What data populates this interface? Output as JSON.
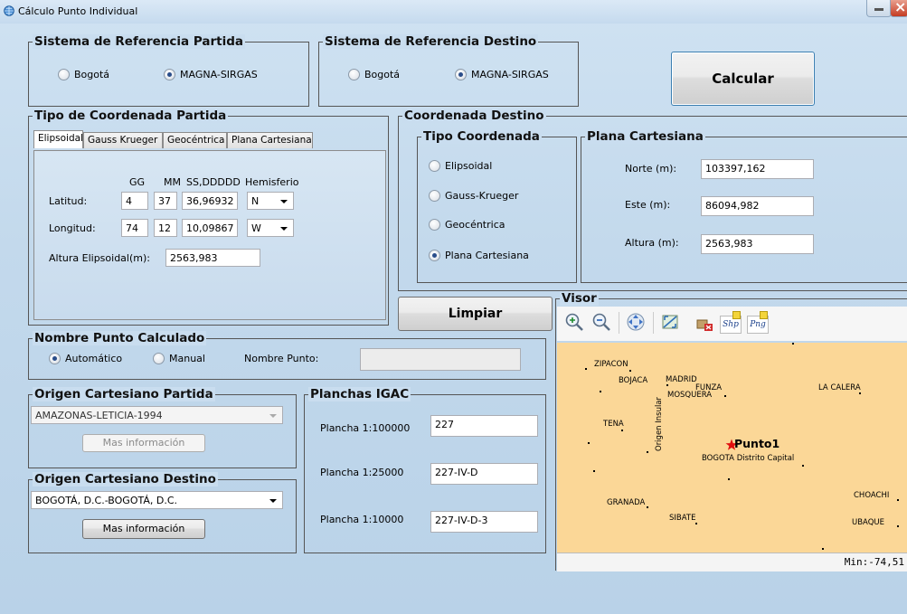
{
  "window": {
    "title": "Cálculo Punto Individual"
  },
  "ref_partida": {
    "title": "Sistema de Referencia Partida",
    "options": [
      "Bogotá",
      "MAGNA-SIRGAS"
    ],
    "selected": "MAGNA-SIRGAS"
  },
  "ref_destino": {
    "title": "Sistema de Referencia Destino",
    "options": [
      "Bogotá",
      "MAGNA-SIRGAS"
    ],
    "selected": "MAGNA-SIRGAS"
  },
  "calcular": {
    "label": "Calcular"
  },
  "tipo_partida": {
    "title": "Tipo de Coordenada Partida",
    "tabs": [
      "Elipsoidal",
      "Gauss Krueger",
      "Geocéntrica",
      "Plana Cartesiana"
    ],
    "active_tab": "Elipsoidal",
    "headers": {
      "gg": "GG",
      "mm": "MM",
      "ss": "SS,DDDDD",
      "hem": "Hemisferio"
    },
    "latitud": {
      "label": "Latitud:",
      "gg": "4",
      "mm": "37",
      "ss": "36,96932",
      "hem": "N"
    },
    "longitud": {
      "label": "Longitud:",
      "gg": "74",
      "mm": "12",
      "ss": "10,09867",
      "hem": "W"
    },
    "altura": {
      "label": "Altura Elipsoidal(m):",
      "value": "2563,983"
    }
  },
  "coord_destino": {
    "title": "Coordenada Destino",
    "tipo": {
      "title": "Tipo Coordenada",
      "options": [
        "Elipsoidal",
        "Gauss-Krueger",
        "Geocéntrica",
        "Plana Cartesiana"
      ],
      "selected": "Plana Cartesiana"
    },
    "plana": {
      "title": "Plana Cartesiana",
      "norte": {
        "label": "Norte (m):",
        "value": "103397,162"
      },
      "este": {
        "label": "Este (m):",
        "value": "86094,982"
      },
      "altura": {
        "label": "Altura (m):",
        "value": "2563,983"
      }
    }
  },
  "limpiar": {
    "label": "Limpiar"
  },
  "nombre_punto": {
    "title": "Nombre Punto Calculado",
    "options": [
      "Automático",
      "Manual"
    ],
    "selected": "Automático",
    "field_label": "Nombre Punto:",
    "value": ""
  },
  "origen_partida": {
    "title": "Origen Cartesiano Partida",
    "value": "AMAZONAS-LETICIA-1994",
    "button": "Mas información"
  },
  "origen_destino": {
    "title": "Origen Cartesiano Destino",
    "value": "BOGOTÁ, D.C.-BOGOTÁ, D.C.",
    "button": "Mas información"
  },
  "planchas": {
    "title": "Planchas IGAC",
    "rows": [
      {
        "label": "Plancha 1:100000",
        "value": "227"
      },
      {
        "label": "Plancha 1:25000",
        "value": "227-IV-D"
      },
      {
        "label": "Plancha 1:10000",
        "value": "227-IV-D-3"
      }
    ]
  },
  "visor": {
    "title": "Visor",
    "toolbar": {
      "shp": "Shp",
      "png": "Png"
    },
    "cities": [
      "ZIPACON",
      "BOJACA",
      "MADRID",
      "FUNZA",
      "MOSQUERA",
      "LA CALERA",
      "TENA",
      "BOGOTA Distrito Capital",
      "GRANADA",
      "SIBATE",
      "CHOACHI",
      "UBAQUE"
    ],
    "vertical_label": "Origen Insular",
    "point_label": "Punto1",
    "status": "Min:-74,51",
    "colors": {
      "map_bg": "#fbd797",
      "point": "#e01010"
    }
  }
}
